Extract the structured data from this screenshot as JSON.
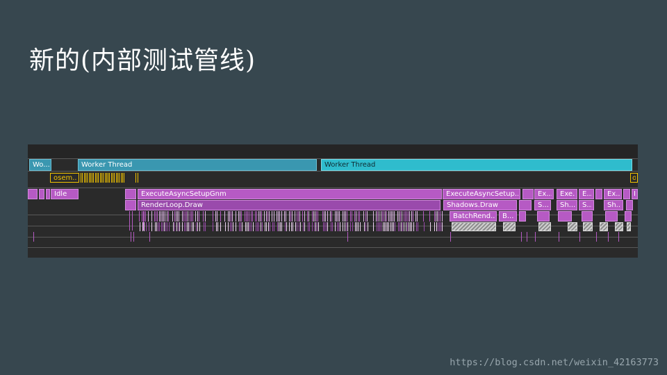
{
  "slide": {
    "title": "新的(内部测试管线)"
  },
  "profiler": {
    "threads": [
      {
        "label": "Wo..."
      },
      {
        "label": "Worker Thread"
      },
      {
        "label": "Worker Thread"
      }
    ],
    "markers": [
      {
        "label": "osem..."
      },
      {
        "label": "o"
      }
    ],
    "jobs": [
      {
        "label": "Idle"
      },
      {
        "label": "ExecuteAsyncSetupGnm"
      },
      {
        "label": "RenderLoop.Draw"
      },
      {
        "label": "ExecuteAsyncSetup..."
      },
      {
        "label": "Shadows.Draw"
      },
      {
        "label": "BatchRend..."
      },
      {
        "label": "B..."
      },
      {
        "label": "Ex..."
      },
      {
        "label": "S..."
      },
      {
        "label": "Exe..."
      },
      {
        "label": "Sh..."
      },
      {
        "label": "E..."
      },
      {
        "label": "S..."
      },
      {
        "label": "Ex..."
      },
      {
        "label": "Sh..."
      },
      {
        "label": "I"
      }
    ]
  },
  "watermark": "https://blog.csdn.net/weixin_42163773"
}
